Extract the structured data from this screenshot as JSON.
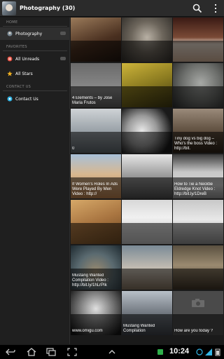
{
  "header": {
    "title": "Photography (30)"
  },
  "sidebar": {
    "sections": {
      "home": "HOME",
      "favorites": "FAVORITES",
      "contact": "CONTACT US"
    },
    "items": [
      {
        "label": "Photography",
        "icon": "photography-icon"
      },
      {
        "label": "All Unreads",
        "icon": "unreads-icon"
      },
      {
        "label": "All Stars",
        "icon": "star-icon"
      },
      {
        "label": "Contact Us",
        "icon": "contact-icon"
      }
    ]
  },
  "tiles": [
    {
      "caption": "",
      "theme": "fur"
    },
    {
      "caption": "",
      "theme": "owl"
    },
    {
      "caption": "",
      "theme": "kitten"
    },
    {
      "caption": "4 Elements – by Jose Maria Frutos",
      "theme": "gray"
    },
    {
      "caption": "",
      "theme": "yellow"
    },
    {
      "caption": "",
      "theme": "cat"
    },
    {
      "caption": "0",
      "theme": "apple"
    },
    {
      "caption": "",
      "theme": "leopards"
    },
    {
      "caption": "Tiny dog vs big dog – Who's the boss Video : http://bit.",
      "theme": "dogs"
    },
    {
      "caption": "If Women's Roles In Ads Were Played By Men Video : http://",
      "theme": "beach"
    },
    {
      "caption": "",
      "theme": "cats"
    },
    {
      "caption": "How to Tie a Necktie Eldredge Knot Video : http://bit.ly/1DreB",
      "theme": "ties"
    },
    {
      "caption": "",
      "theme": "lions"
    },
    {
      "caption": "",
      "theme": "baby"
    },
    {
      "caption": "",
      "theme": "whitecat"
    },
    {
      "caption": "Mustang Wanted Compilation Video : http://bit.ly/1hLrPIk",
      "theme": "fisheye"
    },
    {
      "caption": "",
      "theme": "wolf"
    },
    {
      "caption": "",
      "theme": "owls"
    },
    {
      "caption": "www.omigu.com",
      "theme": "tiger"
    },
    {
      "caption": "Mustang Wanted Compilation",
      "theme": "mountain"
    },
    {
      "caption": "How are you today ?",
      "theme": "placeholder"
    }
  ],
  "statusbar": {
    "time": "10:24"
  },
  "colors": {
    "background": "#1a1a1a",
    "accent": "#33b5e5",
    "star": "#f0b020"
  }
}
